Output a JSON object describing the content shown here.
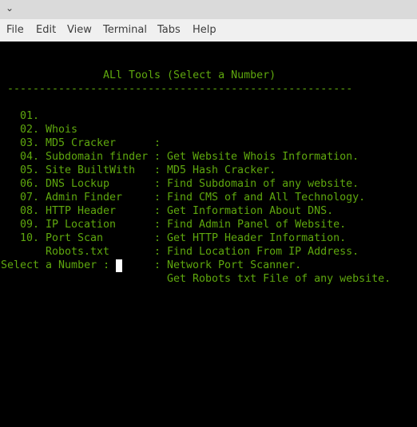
{
  "window": {
    "titlebar_icon": "chevron-down-icon"
  },
  "menu": {
    "items": [
      {
        "label": "File"
      },
      {
        "label": "Edit"
      },
      {
        "label": "View"
      },
      {
        "label": "Terminal"
      },
      {
        "label": "Tabs"
      },
      {
        "label": "Help"
      }
    ]
  },
  "terminal": {
    "title": "ALl Tools (Select a Number)",
    "separator": "------------------------------------------------------",
    "tools": [
      {
        "num": "01.",
        "name": "Whois",
        "desc": "Get Website Whois Information."
      },
      {
        "num": "02.",
        "name": "MD5 Cracker",
        "desc": "MD5 Hash Cracker."
      },
      {
        "num": "03.",
        "name": "Subdomain finder",
        "desc": "Find Subdomain of any website."
      },
      {
        "num": "04.",
        "name": "Site BuiltWith",
        "desc": "Find CMS of and All Technology."
      },
      {
        "num": "05.",
        "name": "DNS Lockup",
        "desc": "Get Information About DNS."
      },
      {
        "num": "06.",
        "name": "Admin Finder",
        "desc": "Find Admin Panel of Website."
      },
      {
        "num": "07.",
        "name": "HTTP Header",
        "desc": "Get HTTP Header Information."
      },
      {
        "num": "08.",
        "name": "IP Location",
        "desc": "Find Location From IP Address."
      },
      {
        "num": "09.",
        "name": "Port Scan",
        "desc": "Network Port Scanner."
      },
      {
        "num": "10.",
        "name": "Robots.txt",
        "desc": "Get Robots txt File of any website."
      }
    ],
    "colon": ":",
    "prompt": "Select a Number : ",
    "text_color": "#5fa80e",
    "background": "#000000",
    "cursor_color": "#ffffff"
  }
}
